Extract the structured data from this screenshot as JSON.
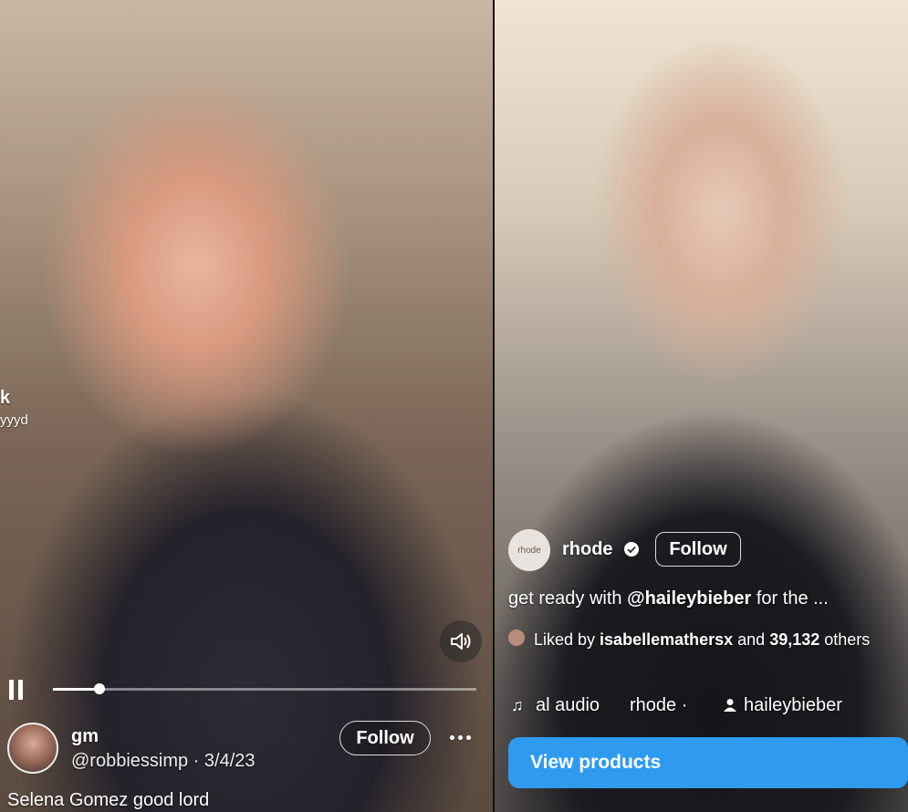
{
  "left": {
    "edge_text_top": "k",
    "edge_text_bottom": "yyyd",
    "progress_fraction": 0.11,
    "user": {
      "name": "gm",
      "meta": "@robbiessimp · 3/4/23"
    },
    "follow_label": "Follow",
    "caption": "Selena Gomez good lord",
    "icons": {
      "sound": "sound-on-icon",
      "pause": "pause-icon",
      "more": "more-options-icon"
    }
  },
  "right": {
    "brand_avatar_text": "rhode",
    "brand_name": "rhode",
    "follow_label": "Follow",
    "caption_prefix": "get ready with ",
    "caption_mention": "@haileybieber",
    "caption_suffix": " for the ...",
    "liked_prefix": "Liked by ",
    "liked_user": "isabellemathersx",
    "liked_middle": " and ",
    "liked_count": "39,132",
    "liked_suffix": " others",
    "audio_label": "al audio",
    "audio_artist": "rhode ·",
    "audio_user": "haileybieber",
    "view_products_label": "View products",
    "accent_color": "#2e9bf0",
    "icons": {
      "verified": "verified-badge-icon",
      "music": "music-note-icon",
      "person": "person-icon"
    }
  }
}
